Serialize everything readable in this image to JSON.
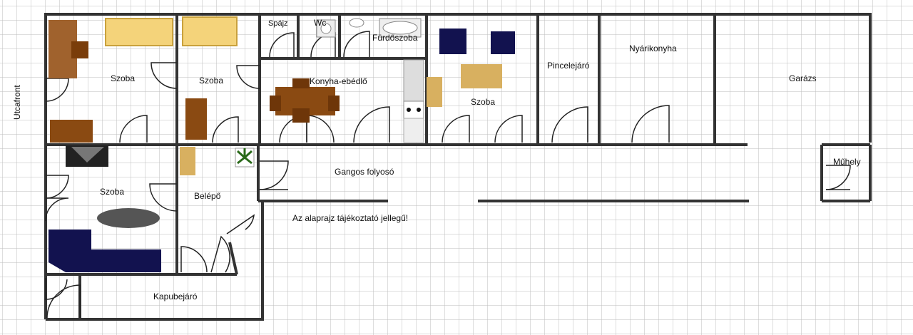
{
  "labels": {
    "street_front": "Utcafront",
    "room_top_left": "Szoba",
    "room_top_2": "Szoba",
    "pantry": "Spájz",
    "wc": "Wc",
    "bathroom": "Fürdőszoba",
    "kitchen_dining": "Konyha-ebédlő",
    "room_top_middle": "Szoba",
    "cellar_entrance": "Pincelejáró",
    "summer_kitchen": "Nyárikonyha",
    "garage": "Garázs",
    "room_bottom_left": "Szoba",
    "entrance": "Belépő",
    "corridor": "Gangos folyosó",
    "workshop": "Műhely",
    "gateway": "Kapubejáró",
    "disclaimer": "Az alaprajz tájékoztató jellegű!"
  },
  "colors": {
    "wall": "#333333",
    "grid": "#bdbdbd",
    "wood": "#8a4a12",
    "yellow_furniture": "#f4d37a",
    "navy_furniture": "#12124f",
    "tan": "#d8b060"
  }
}
